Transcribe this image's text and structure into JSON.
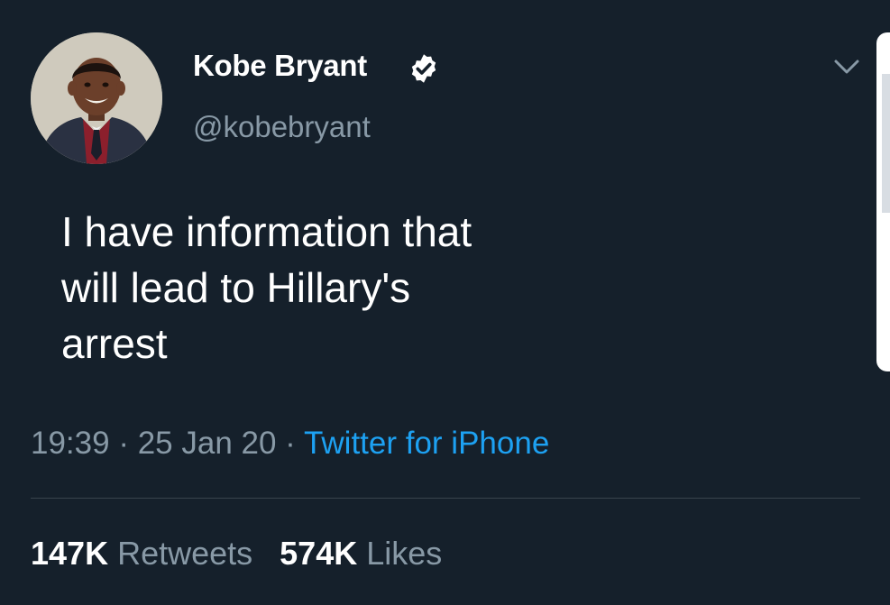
{
  "tweet": {
    "author": {
      "display_name": "Kobe Bryant",
      "handle": "@kobebryant",
      "verified": true,
      "avatar": "child-portrait-avatar"
    },
    "text": "I have information that\nwill lead to Hillary's\narrest",
    "time": "19:39",
    "separator": " · ",
    "date": "25 Jan 20",
    "source": "Twitter for iPhone",
    "stats": {
      "retweets_count": "147K",
      "retweets_label": "Retweets",
      "likes_count": "574K",
      "likes_label": "Likes"
    },
    "menu_icon": "chevron-down-icon"
  },
  "colors": {
    "background": "#15202b",
    "primary_text": "#ffffff",
    "secondary_text": "#8899a6",
    "accent": "#1da1f2",
    "divider": "#38444d"
  }
}
